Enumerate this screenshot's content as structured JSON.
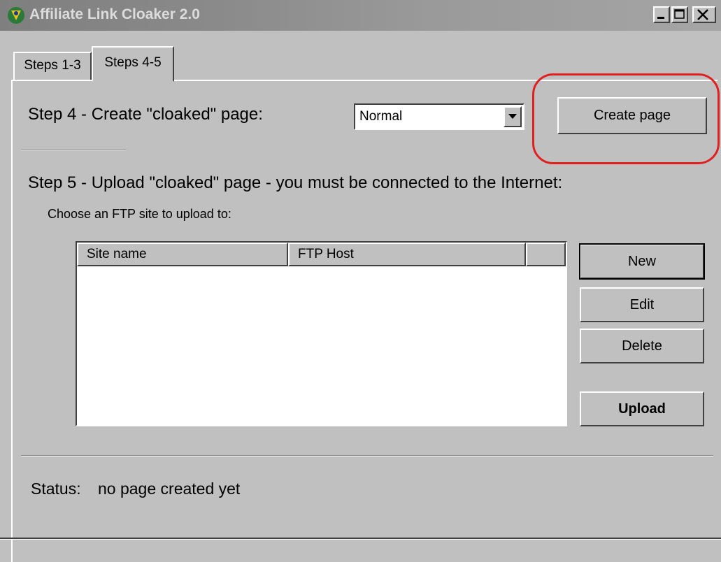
{
  "window": {
    "title": "Affiliate Link Cloaker 2.0",
    "icon": "app-icon",
    "caption_buttons": [
      "minimize-icon",
      "maximize-icon",
      "close-icon"
    ]
  },
  "tabs": [
    {
      "label": "Steps 1-3",
      "active": false
    },
    {
      "label": "Steps 4-5",
      "active": true
    }
  ],
  "step4": {
    "label": "Step 4 - Create \"cloaked\" page:",
    "dropdown_value": "Normal",
    "create_button": "Create page"
  },
  "step5": {
    "label": "Step 5 - Upload \"cloaked\" page - you must be connected to the Internet:",
    "ftp_prompt": "Choose an FTP site to upload to:",
    "columns": [
      "Site name",
      "FTP Host",
      ""
    ],
    "rows": [],
    "buttons": {
      "new": "New",
      "edit": "Edit",
      "delete": "Delete",
      "upload": "Upload"
    }
  },
  "status": {
    "label": "Status:",
    "value": "no page created yet"
  },
  "colors": {
    "face": "#c0c0c0",
    "highlight_annotation": "#e02020"
  }
}
